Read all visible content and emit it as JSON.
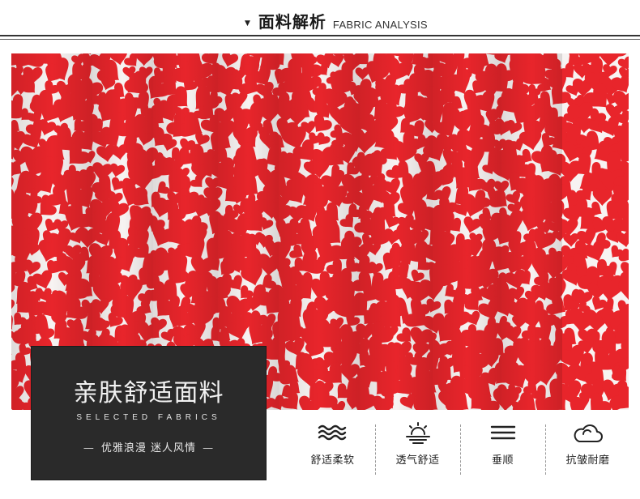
{
  "header": {
    "marker": "▼",
    "title_cn": "面料解析",
    "title_en": "FABRIC ANALYSIS"
  },
  "fabric_photo": {
    "subject": "red heart-print fabric",
    "colors": {
      "red": "#e8252b",
      "white": "#f7f3f2"
    }
  },
  "card": {
    "title": "亲肤舒适面料",
    "subtitle": "SELECTED FABRICS",
    "slogan_dash_left": "—",
    "slogan": "优雅浪漫 迷人风情",
    "slogan_dash_right": "—",
    "background": "#2a2a2a"
  },
  "features": [
    {
      "icon": "waves-icon",
      "label": "舒适柔软"
    },
    {
      "icon": "sun-icon",
      "label": "透气舒适"
    },
    {
      "icon": "lines-icon",
      "label": "垂顺"
    },
    {
      "icon": "cloud-icon",
      "label": "抗皱耐磨"
    }
  ]
}
